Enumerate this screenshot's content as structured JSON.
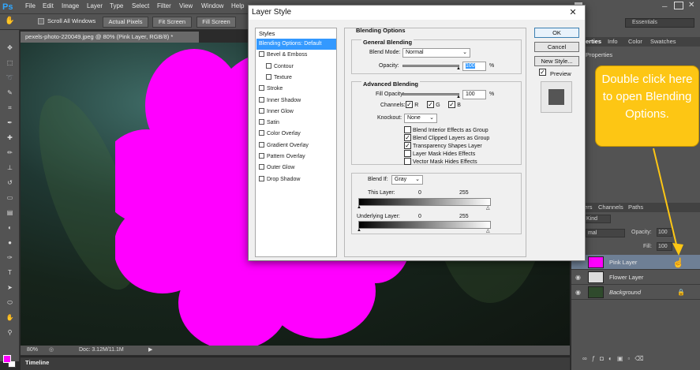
{
  "app": {
    "logo": "Ps",
    "menu": [
      "File",
      "Edit",
      "Image",
      "Layer",
      "Type",
      "Select",
      "Filter",
      "View",
      "Window",
      "Help"
    ]
  },
  "options_bar": {
    "scroll_all_windows": "Scroll All Windows",
    "actual_pixels": "Actual Pixels",
    "fit_screen": "Fit Screen",
    "fill_screen": "Fill Screen"
  },
  "document": {
    "tab_title": "pexels-photo-220049.jpeg @ 80% (Pink Layer, RGB/8) *",
    "zoom": "80%",
    "doc_size": "Doc: 3.12M/11.1M",
    "timeline_label": "Timeline",
    "flower_color": "#ff00ff"
  },
  "right_panel": {
    "workspace": "Essentials",
    "props_tabs": [
      "erties",
      "Info",
      "Color",
      "Swatches"
    ],
    "props_title": "Properties",
    "layers_tabs": [
      "Layers",
      "Channels",
      "Paths"
    ],
    "kind_label": "Kind",
    "blend_mode": "mal",
    "opacity_label": "Opacity:",
    "opacity_value": "100",
    "fill_label": "Fill:",
    "fill_value": "100",
    "layers": [
      {
        "name": "Pink Layer",
        "thumb": "#ff00ff"
      },
      {
        "name": "Flower Layer",
        "thumb": "#dcdcdc"
      },
      {
        "name": "Background",
        "thumb": "#2f4a2c"
      }
    ]
  },
  "callout": {
    "text": "Double click here to open Blending Options."
  },
  "dialog": {
    "title": "Layer Style",
    "styles_header": "Styles",
    "styles": [
      {
        "label": "Blending Options: Default",
        "checkbox": false,
        "selected": true,
        "indent": false
      },
      {
        "label": "Bevel & Emboss",
        "checkbox": true,
        "selected": false,
        "indent": false
      },
      {
        "label": "Contour",
        "checkbox": true,
        "selected": false,
        "indent": true
      },
      {
        "label": "Texture",
        "checkbox": true,
        "selected": false,
        "indent": true
      },
      {
        "label": "Stroke",
        "checkbox": true,
        "selected": false,
        "indent": false
      },
      {
        "label": "Inner Shadow",
        "checkbox": true,
        "selected": false,
        "indent": false
      },
      {
        "label": "Inner Glow",
        "checkbox": true,
        "selected": false,
        "indent": false
      },
      {
        "label": "Satin",
        "checkbox": true,
        "selected": false,
        "indent": false
      },
      {
        "label": "Color Overlay",
        "checkbox": true,
        "selected": false,
        "indent": false
      },
      {
        "label": "Gradient Overlay",
        "checkbox": true,
        "selected": false,
        "indent": false
      },
      {
        "label": "Pattern Overlay",
        "checkbox": true,
        "selected": false,
        "indent": false
      },
      {
        "label": "Outer Glow",
        "checkbox": true,
        "selected": false,
        "indent": false
      },
      {
        "label": "Drop Shadow",
        "checkbox": true,
        "selected": false,
        "indent": false
      }
    ],
    "blending_options": "Blending Options",
    "general_blending": "General Blending",
    "blend_mode_label": "Blend Mode:",
    "blend_mode_value": "Normal",
    "opacity_label": "Opacity:",
    "opacity_value": "100",
    "percent": "%",
    "advanced_blending": "Advanced Blending",
    "fill_opacity_label": "Fill Opacity:",
    "fill_opacity_value": "100",
    "channels_label": "Channels:",
    "channels": [
      "R",
      "G",
      "B"
    ],
    "knockout_label": "Knockout:",
    "knockout_value": "None",
    "adv_checks": [
      {
        "label": "Blend Interior Effects as Group",
        "checked": false
      },
      {
        "label": "Blend Clipped Layers as Group",
        "checked": true
      },
      {
        "label": "Transparency Shapes Layer",
        "checked": true
      },
      {
        "label": "Layer Mask Hides Effects",
        "checked": false
      },
      {
        "label": "Vector Mask Hides Effects",
        "checked": false
      }
    ],
    "blend_if_label": "Blend If:",
    "blend_if_value": "Gray",
    "this_layer_label": "This Layer:",
    "underlying_label": "Underlying Layer:",
    "range_min": "0",
    "range_max": "255",
    "ok": "OK",
    "cancel": "Cancel",
    "new_style": "New Style...",
    "preview": "Preview"
  }
}
